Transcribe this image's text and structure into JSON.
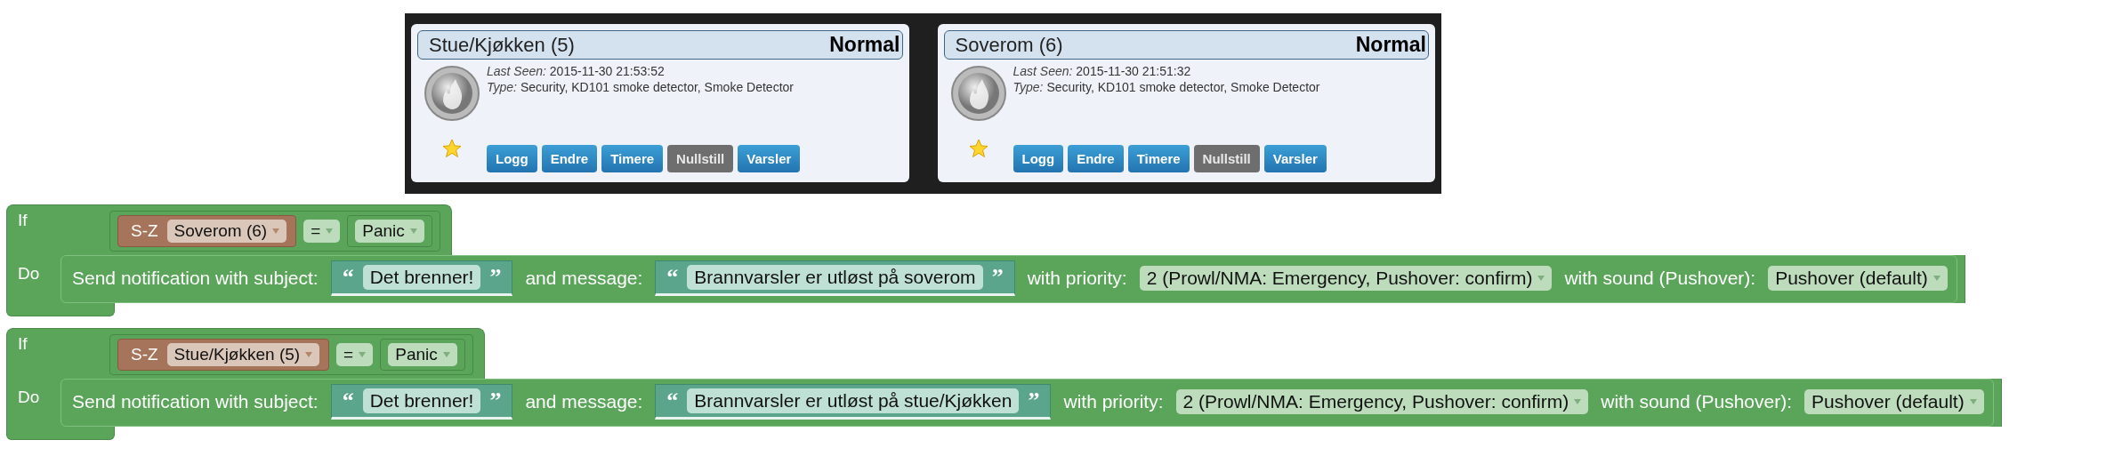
{
  "devices": [
    {
      "name": "Stue/Kjøkken (5)",
      "status": "Normal",
      "last_seen_label": "Last Seen:",
      "last_seen": "2015-11-30 21:53:52",
      "type_label": "Type:",
      "type": "Security, KD101 smoke detector, Smoke Detector",
      "favorite": true,
      "buttons": [
        {
          "label": "Logg",
          "disabled": false
        },
        {
          "label": "Endre",
          "disabled": false
        },
        {
          "label": "Timere",
          "disabled": false
        },
        {
          "label": "Nullstill",
          "disabled": true
        },
        {
          "label": "Varsler",
          "disabled": false
        }
      ]
    },
    {
      "name": "Soverom (6)",
      "status": "Normal",
      "last_seen_label": "Last Seen:",
      "last_seen": "2015-11-30 21:51:32",
      "type_label": "Type:",
      "type": "Security, KD101 smoke detector, Smoke Detector",
      "favorite": true,
      "buttons": [
        {
          "label": "Logg",
          "disabled": false
        },
        {
          "label": "Endre",
          "disabled": false
        },
        {
          "label": "Timere",
          "disabled": false
        },
        {
          "label": "Nullstill",
          "disabled": true
        },
        {
          "label": "Varsler",
          "disabled": false
        }
      ]
    }
  ],
  "rules": [
    {
      "if_label": "If",
      "do_label": "Do",
      "condition": {
        "prefix": "S-Z",
        "device": "Soverom (6)",
        "operator": "=",
        "value": "Panic"
      },
      "action": {
        "text": "Send notification with subject:",
        "subject": {
          "open": "“",
          "value": "Det brenner!",
          "close": "”"
        },
        "message_label": "and message:",
        "message": {
          "open": "“",
          "value": "Brannvarsler er utløst på soverom",
          "close": "”"
        },
        "priority_label": "with priority:",
        "priority": "2 (Prowl/NMA: Emergency, Pushover: confirm)",
        "sound_label": "with sound (Pushover):",
        "sound": "Pushover (default)"
      }
    },
    {
      "if_label": "If",
      "do_label": "Do",
      "condition": {
        "prefix": "S-Z",
        "device": "Stue/Kjøkken (5)",
        "operator": "=",
        "value": "Panic"
      },
      "action": {
        "text": "Send notification with subject:",
        "subject": {
          "open": "“",
          "value": "Det brenner!",
          "close": "”"
        },
        "message_label": "and message:",
        "message": {
          "open": "“",
          "value": "Brannvarsler er utløst på stue/Kjøkken",
          "close": "”"
        },
        "priority_label": "with priority:",
        "priority": "2 (Prowl/NMA: Emergency, Pushover: confirm)",
        "sound_label": "with sound (Pushover):",
        "sound": "Pushover (default)"
      }
    }
  ]
}
